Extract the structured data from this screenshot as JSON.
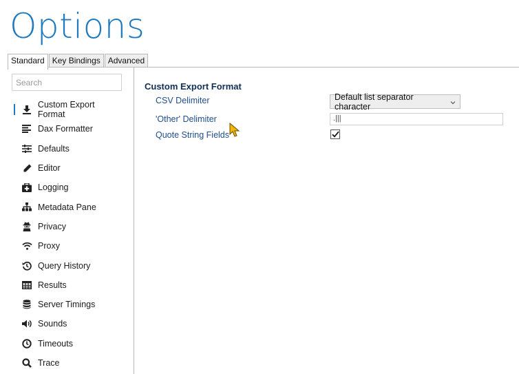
{
  "title": "Options",
  "tabs": [
    {
      "label": "Standard",
      "active": true
    },
    {
      "label": "Key Bindings",
      "active": false
    },
    {
      "label": "Advanced",
      "active": false
    }
  ],
  "search": {
    "placeholder": "Search"
  },
  "nav": {
    "active": "Custom Export Format",
    "items": [
      {
        "label": "Custom Export Format",
        "icon": "download-icon"
      },
      {
        "label": "Dax Formatter",
        "icon": "align-left-icon"
      },
      {
        "label": "Defaults",
        "icon": "sliders-icon"
      },
      {
        "label": "Editor",
        "icon": "pencil-icon"
      },
      {
        "label": "Logging",
        "icon": "medkit-icon"
      },
      {
        "label": "Metadata Pane",
        "icon": "sitemap-icon"
      },
      {
        "label": "Privacy",
        "icon": "user-secret-icon"
      },
      {
        "label": "Proxy",
        "icon": "wifi-icon"
      },
      {
        "label": "Query History",
        "icon": "history-icon"
      },
      {
        "label": "Results",
        "icon": "table-icon"
      },
      {
        "label": "Server Timings",
        "icon": "database-icon"
      },
      {
        "label": "Sounds",
        "icon": "volume-icon"
      },
      {
        "label": "Timeouts",
        "icon": "clock-icon"
      },
      {
        "label": "Trace",
        "icon": "search-icon"
      }
    ]
  },
  "main": {
    "section_title": "Custom Export Format",
    "csv_delimiter": {
      "label": "CSV Delimiter",
      "value": "Default list separator character"
    },
    "other_delimiter": {
      "label": "'Other' Delimiter",
      "value": ".|||"
    },
    "quote_string_fields": {
      "label": "Quote String Fields",
      "checked": true
    }
  },
  "colors": {
    "accent": "#1f7ac0",
    "label": "#1f4e8c",
    "section": "#0f2f57",
    "cursor": "#f2b705"
  }
}
